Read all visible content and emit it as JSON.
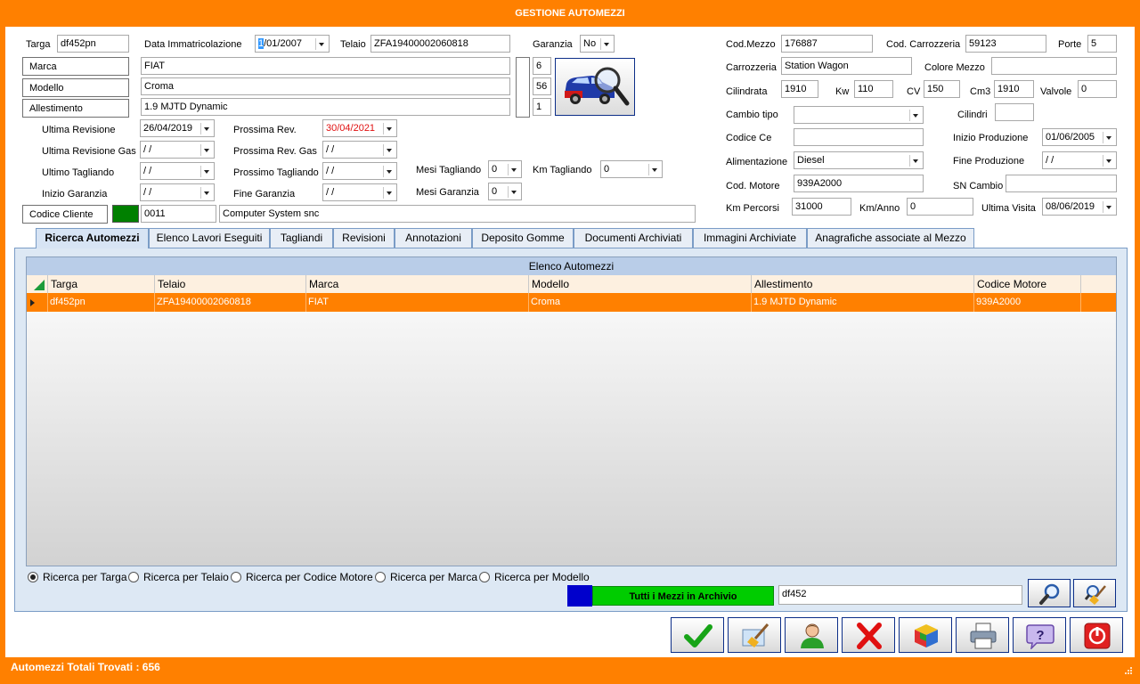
{
  "window": {
    "title": "GESTIONE AUTOMEZZI"
  },
  "vehicle": {
    "targa_label": "Targa",
    "targa": "df452pn",
    "data_imm_label": "Data Immatricolazione",
    "data_imm_cursor": "1",
    "data_imm_rest": "/01/2007",
    "telaio_label": "Telaio",
    "telaio": "ZFA19400002060818",
    "garanzia_label": "Garanzia",
    "garanzia": "No",
    "marca_btn": "Marca",
    "marca": "FIAT",
    "marca_code": "6",
    "modello_btn": "Modello",
    "modello": "Croma",
    "modello_code": "56",
    "allestimento_btn": "Allestimento",
    "allestimento": "1.9 MJTD Dynamic",
    "allestimento_code": "1",
    "ultima_revisione_label": "Ultima Revisione",
    "ultima_revisione": "26/04/2019",
    "prossima_rev_label": "Prossima Rev.",
    "prossima_rev": "30/04/2021",
    "ultima_revisione_gas_label": "Ultima Revisione Gas",
    "ultima_revisione_gas": " /  /",
    "prossima_rev_gas_label": "Prossima Rev. Gas",
    "prossima_rev_gas": " /  /",
    "ultimo_tagliando_label": "Ultimo Tagliando",
    "ultimo_tagliando": " /  /",
    "prossimo_tagliando_label": "Prossimo Tagliando",
    "prossimo_tagliando": " /  /",
    "mesi_tagliando_label": "Mesi Tagliando",
    "mesi_tagliando": "0",
    "km_tagliando_label": "Km Tagliando",
    "km_tagliando": "0",
    "inizio_garanzia_label": "Inizio Garanzia",
    "inizio_garanzia": " /  /",
    "fine_garanzia_label": "Fine Garanzia",
    "fine_garanzia": " /  /",
    "mesi_garanzia_label": "Mesi Garanzia",
    "mesi_garanzia": "0",
    "codice_cliente_btn": "Codice Cliente",
    "codice_cliente": "0011",
    "cliente_nome": "Computer System snc",
    "cliente_color": "#008000"
  },
  "details": {
    "cod_mezzo_label": "Cod.Mezzo",
    "cod_mezzo": "176887",
    "cod_carrozzeria_label": "Cod. Carrozzeria",
    "cod_carrozzeria": "59123",
    "porte_label": "Porte",
    "porte": "5",
    "carrozzeria_label": "Carrozzeria",
    "carrozzeria": "Station Wagon",
    "colore_label": "Colore Mezzo",
    "colore": "",
    "cilindrata_label": "Cilindrata",
    "cilindrata": "1910",
    "kw_label": "Kw",
    "kw": "110",
    "cv_label": "CV",
    "cv": "150",
    "cm3_label": "Cm3",
    "cm3": "1910",
    "valvole_label": "Valvole",
    "valvole": "0",
    "cambio_tipo_label": "Cambio tipo",
    "cambio_tipo": "",
    "cilindri_label": "Cilindri",
    "cilindri": "",
    "codice_ce_label": "Codice Ce",
    "codice_ce": "",
    "inizio_produzione_label": "Inizio Produzione",
    "inizio_produzione": "01/06/2005",
    "alimentazione_label": "Alimentazione",
    "alimentazione": "Diesel",
    "fine_produzione_label": "Fine Produzione",
    "fine_produzione": " /  /",
    "cod_motore_label": "Cod. Motore",
    "cod_motore": "939A2000",
    "sn_cambio_label": "SN Cambio",
    "sn_cambio": "",
    "km_percorsi_label": "Km Percorsi",
    "km_percorsi": "31000",
    "km_anno_label": "Km/Anno",
    "km_anno": "0",
    "ultima_visita_label": "Ultima Visita",
    "ultima_visita": "08/06/2019"
  },
  "tabs": [
    "Ricerca Automezzi",
    "Elenco Lavori Eseguiti",
    "Tagliandi",
    "Revisioni",
    "Annotazioni",
    "Deposito Gomme",
    "Documenti Archiviati",
    "Immagini Archiviate",
    "Anagrafiche associate al Mezzo"
  ],
  "grid": {
    "caption": "Elenco Automezzi",
    "columns": [
      "Targa",
      "Telaio",
      "Marca",
      "Modello",
      "Allestimento",
      "Codice Motore"
    ],
    "rows": [
      [
        "df452pn",
        "ZFA19400002060818",
        "FIAT",
        "Croma",
        "1.9 MJTD Dynamic",
        "939A2000"
      ]
    ]
  },
  "search": {
    "options": [
      "Ricerca per Targa",
      "Ricerca per Telaio",
      "Ricerca per Codice Motore",
      "Ricerca per Marca",
      "Ricerca per Modello"
    ],
    "selected": "Ricerca per Targa",
    "all_button": "Tutti i Mezzi in Archivio",
    "query": "df452"
  },
  "toolbar": [
    "confirm-icon",
    "clean-icon",
    "customer-icon",
    "delete-icon",
    "cube-icon",
    "printer-icon",
    "help-icon",
    "power-icon"
  ],
  "status": {
    "text": "Automezzi Totali Trovati : 656"
  },
  "colors": {
    "accent": "#ff8000",
    "panel": "#dde8f4",
    "grid_header": "#b9cde8"
  }
}
